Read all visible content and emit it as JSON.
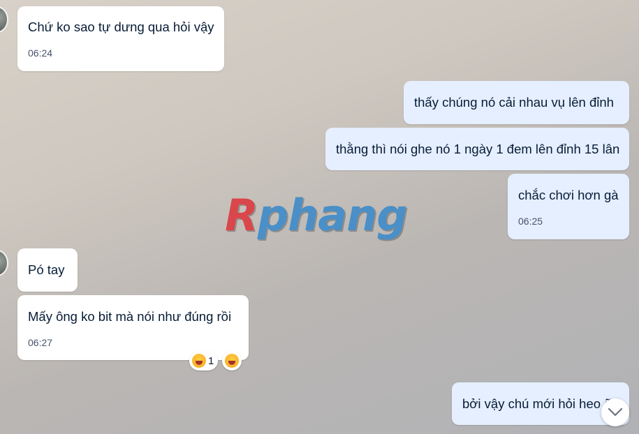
{
  "watermark": {
    "first": "R",
    "rest": "phang"
  },
  "messages": [
    {
      "text": "Chứ ko sao tự dưng qua hỏi vậy",
      "time": "06:24"
    },
    {
      "text": "thấy chúng nó cải nhau vụ lên đỉnh"
    },
    {
      "text": "thằng thì nói ghe nó 1 ngày 1 đem lên đỉnh 15 lân"
    },
    {
      "text": "chắc chơi hơn gà",
      "time": "06:25"
    },
    {
      "text": "Pó tay"
    },
    {
      "text": "Mấy ông ko bit mà nói như đúng rồi",
      "time": "06:27",
      "reaction_count": "1"
    },
    {
      "text": "bởi vậy chú mới hỏi heo ã"
    }
  ],
  "icons": {
    "reaction": "laughing-face-icon",
    "scroll": "chevron-down-icon"
  }
}
